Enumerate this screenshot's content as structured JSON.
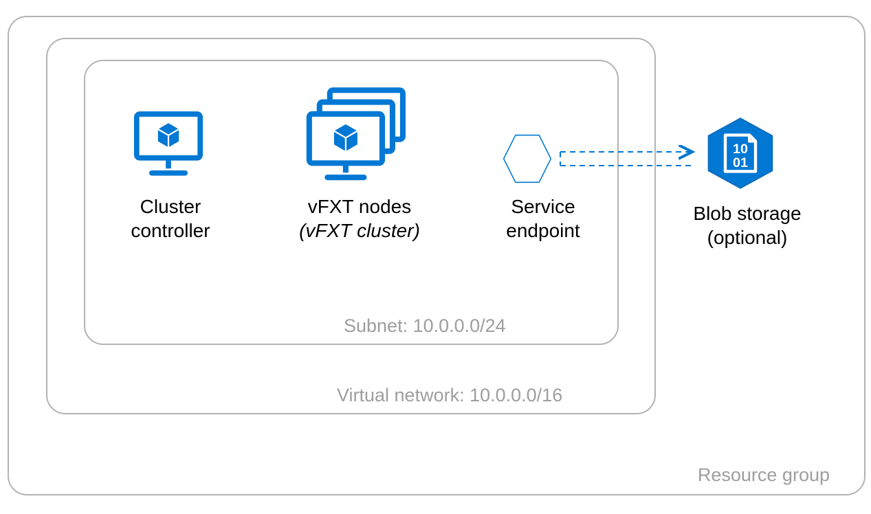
{
  "colors": {
    "azure_blue": "#0078D4",
    "azure_blue_dark": "#106EBE",
    "border_gray": "#b3b3b3",
    "label_gray": "#9e9e9e"
  },
  "labels": {
    "resource_group": "Resource group",
    "vnet": "Virtual network: 10.0.0.0/16",
    "subnet": "Subnet: 10.0.0.0/24",
    "cluster_controller_l1": "Cluster",
    "cluster_controller_l2": "controller",
    "vfxt_l1": "vFXT nodes",
    "vfxt_l2": "(vFXT cluster)",
    "service_endpoint_l1": "Service",
    "service_endpoint_l2": "endpoint",
    "blob_l1": "Blob storage",
    "blob_l2": "(optional)"
  }
}
